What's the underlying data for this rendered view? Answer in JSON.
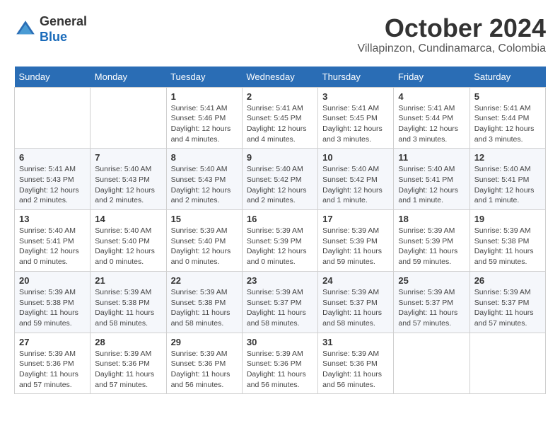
{
  "header": {
    "logo_line1": "General",
    "logo_line2": "Blue",
    "month_title": "October 2024",
    "location": "Villapinzon, Cundinamarca, Colombia"
  },
  "days_of_week": [
    "Sunday",
    "Monday",
    "Tuesday",
    "Wednesday",
    "Thursday",
    "Friday",
    "Saturday"
  ],
  "weeks": [
    [
      {
        "num": "",
        "info": ""
      },
      {
        "num": "",
        "info": ""
      },
      {
        "num": "1",
        "info": "Sunrise: 5:41 AM\nSunset: 5:46 PM\nDaylight: 12 hours and 4 minutes."
      },
      {
        "num": "2",
        "info": "Sunrise: 5:41 AM\nSunset: 5:45 PM\nDaylight: 12 hours and 4 minutes."
      },
      {
        "num": "3",
        "info": "Sunrise: 5:41 AM\nSunset: 5:45 PM\nDaylight: 12 hours and 3 minutes."
      },
      {
        "num": "4",
        "info": "Sunrise: 5:41 AM\nSunset: 5:44 PM\nDaylight: 12 hours and 3 minutes."
      },
      {
        "num": "5",
        "info": "Sunrise: 5:41 AM\nSunset: 5:44 PM\nDaylight: 12 hours and 3 minutes."
      }
    ],
    [
      {
        "num": "6",
        "info": "Sunrise: 5:41 AM\nSunset: 5:43 PM\nDaylight: 12 hours and 2 minutes."
      },
      {
        "num": "7",
        "info": "Sunrise: 5:40 AM\nSunset: 5:43 PM\nDaylight: 12 hours and 2 minutes."
      },
      {
        "num": "8",
        "info": "Sunrise: 5:40 AM\nSunset: 5:43 PM\nDaylight: 12 hours and 2 minutes."
      },
      {
        "num": "9",
        "info": "Sunrise: 5:40 AM\nSunset: 5:42 PM\nDaylight: 12 hours and 2 minutes."
      },
      {
        "num": "10",
        "info": "Sunrise: 5:40 AM\nSunset: 5:42 PM\nDaylight: 12 hours and 1 minute."
      },
      {
        "num": "11",
        "info": "Sunrise: 5:40 AM\nSunset: 5:41 PM\nDaylight: 12 hours and 1 minute."
      },
      {
        "num": "12",
        "info": "Sunrise: 5:40 AM\nSunset: 5:41 PM\nDaylight: 12 hours and 1 minute."
      }
    ],
    [
      {
        "num": "13",
        "info": "Sunrise: 5:40 AM\nSunset: 5:41 PM\nDaylight: 12 hours and 0 minutes."
      },
      {
        "num": "14",
        "info": "Sunrise: 5:40 AM\nSunset: 5:40 PM\nDaylight: 12 hours and 0 minutes."
      },
      {
        "num": "15",
        "info": "Sunrise: 5:39 AM\nSunset: 5:40 PM\nDaylight: 12 hours and 0 minutes."
      },
      {
        "num": "16",
        "info": "Sunrise: 5:39 AM\nSunset: 5:39 PM\nDaylight: 12 hours and 0 minutes."
      },
      {
        "num": "17",
        "info": "Sunrise: 5:39 AM\nSunset: 5:39 PM\nDaylight: 11 hours and 59 minutes."
      },
      {
        "num": "18",
        "info": "Sunrise: 5:39 AM\nSunset: 5:39 PM\nDaylight: 11 hours and 59 minutes."
      },
      {
        "num": "19",
        "info": "Sunrise: 5:39 AM\nSunset: 5:38 PM\nDaylight: 11 hours and 59 minutes."
      }
    ],
    [
      {
        "num": "20",
        "info": "Sunrise: 5:39 AM\nSunset: 5:38 PM\nDaylight: 11 hours and 59 minutes."
      },
      {
        "num": "21",
        "info": "Sunrise: 5:39 AM\nSunset: 5:38 PM\nDaylight: 11 hours and 58 minutes."
      },
      {
        "num": "22",
        "info": "Sunrise: 5:39 AM\nSunset: 5:38 PM\nDaylight: 11 hours and 58 minutes."
      },
      {
        "num": "23",
        "info": "Sunrise: 5:39 AM\nSunset: 5:37 PM\nDaylight: 11 hours and 58 minutes."
      },
      {
        "num": "24",
        "info": "Sunrise: 5:39 AM\nSunset: 5:37 PM\nDaylight: 11 hours and 58 minutes."
      },
      {
        "num": "25",
        "info": "Sunrise: 5:39 AM\nSunset: 5:37 PM\nDaylight: 11 hours and 57 minutes."
      },
      {
        "num": "26",
        "info": "Sunrise: 5:39 AM\nSunset: 5:37 PM\nDaylight: 11 hours and 57 minutes."
      }
    ],
    [
      {
        "num": "27",
        "info": "Sunrise: 5:39 AM\nSunset: 5:36 PM\nDaylight: 11 hours and 57 minutes."
      },
      {
        "num": "28",
        "info": "Sunrise: 5:39 AM\nSunset: 5:36 PM\nDaylight: 11 hours and 57 minutes."
      },
      {
        "num": "29",
        "info": "Sunrise: 5:39 AM\nSunset: 5:36 PM\nDaylight: 11 hours and 56 minutes."
      },
      {
        "num": "30",
        "info": "Sunrise: 5:39 AM\nSunset: 5:36 PM\nDaylight: 11 hours and 56 minutes."
      },
      {
        "num": "31",
        "info": "Sunrise: 5:39 AM\nSunset: 5:36 PM\nDaylight: 11 hours and 56 minutes."
      },
      {
        "num": "",
        "info": ""
      },
      {
        "num": "",
        "info": ""
      }
    ]
  ]
}
